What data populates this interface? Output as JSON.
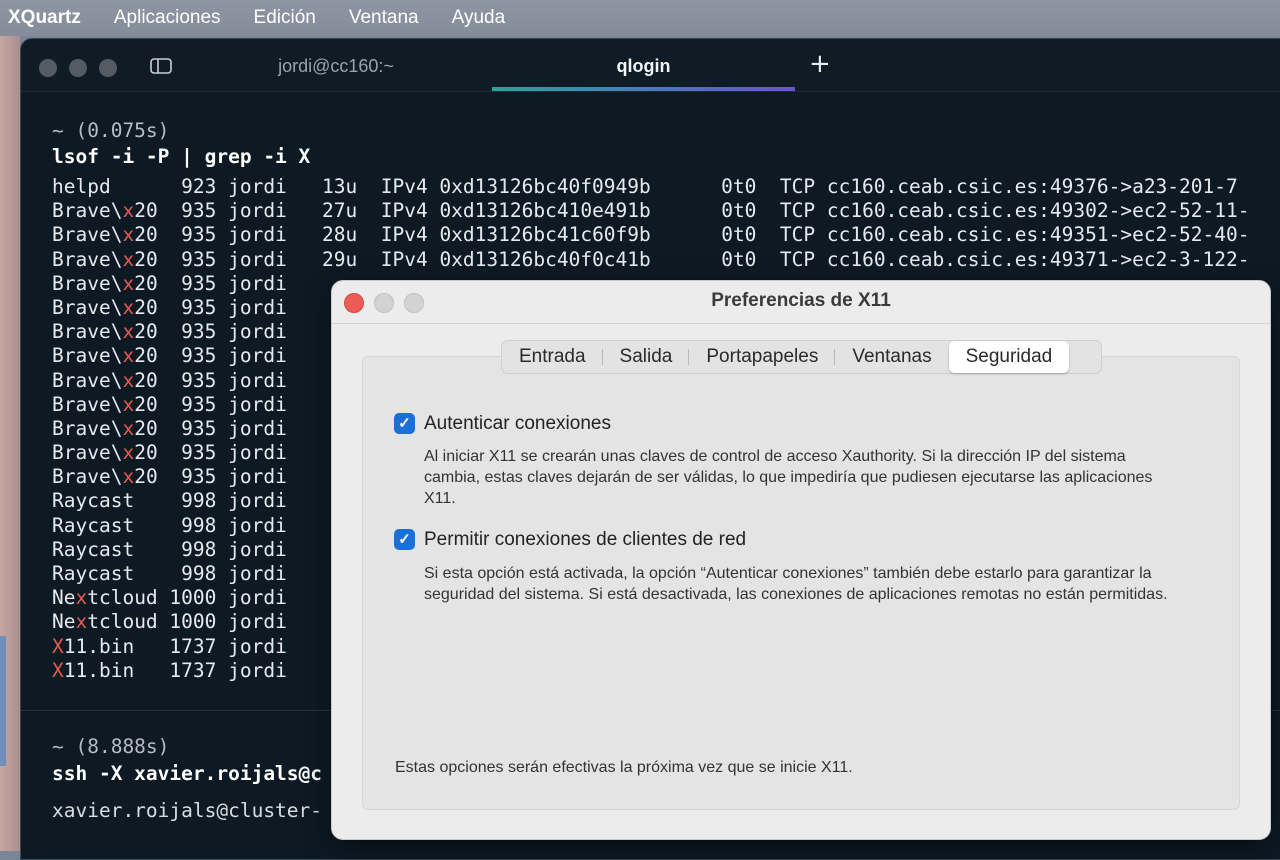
{
  "menubar": {
    "app_name": "XQuartz",
    "items": [
      "Aplicaciones",
      "Edición",
      "Ventana",
      "Ayuda"
    ]
  },
  "terminal": {
    "tabs": [
      {
        "label": "jordi@cc160:~",
        "active": false
      },
      {
        "label": "qlogin",
        "active": true
      }
    ],
    "new_tab_label": "+",
    "block1": {
      "prompt": "~ (0.075s)",
      "command": "lsof -i -P | grep -i X"
    },
    "output_lines": [
      "helpd      923 jordi   13u  IPv4 0xd13126bc40f0949b      0t0  TCP cc160.ceab.csic.es:49376->a23-201-7",
      "Brave\\x20  935 jordi   27u  IPv4 0xd13126bc410e491b      0t0  TCP cc160.ceab.csic.es:49302->ec2-52-11-",
      "Brave\\x20  935 jordi   28u  IPv4 0xd13126bc41c60f9b      0t0  TCP cc160.ceab.csic.es:49351->ec2-52-40-",
      "Brave\\x20  935 jordi   29u  IPv4 0xd13126bc40f0c41b      0t0  TCP cc160.ceab.csic.es:49371->ec2-3-122-",
      "Brave\\x20  935 jordi",
      "Brave\\x20  935 jordi",
      "Brave\\x20  935 jordi",
      "Brave\\x20  935 jordi",
      "Brave\\x20  935 jordi",
      "Brave\\x20  935 jordi",
      "Brave\\x20  935 jordi",
      "Brave\\x20  935 jordi",
      "Brave\\x20  935 jordi",
      "Raycast    998 jordi",
      "Raycast    998 jordi",
      "Raycast    998 jordi",
      "Raycast    998 jordi",
      "Nextcloud 1000 jordi",
      "Nextcloud 1000 jordi",
      "X11.bin   1737 jordi",
      "X11.bin   1737 jordi"
    ],
    "block2": {
      "prompt": "~ (8.888s)",
      "command": "ssh -X xavier.roijals@c",
      "output": "xavier.roijals@cluster-"
    }
  },
  "dialog": {
    "title": "Preferencias de X11",
    "tabs": [
      "Entrada",
      "Salida",
      "Portapapeles",
      "Ventanas",
      "Seguridad"
    ],
    "selected_tab": "Seguridad",
    "options": [
      {
        "label": "Autenticar conexiones",
        "checked": true,
        "description": "Al iniciar X11 se crearán unas claves de control de acceso Xauthority. Si la dirección IP del sistema cambia, estas claves dejarán de ser válidas, lo que impediría que pudiesen ejecutarse las aplicaciones X11."
      },
      {
        "label": "Permitir conexiones de clientes de red",
        "checked": true,
        "description": "Si esta opción está activada, la opción “Autenticar conexiones” también debe estarlo para garantizar la seguridad del sistema. Si está desactivada, las conexiones de aplicaciones remotas no están permitidas."
      }
    ],
    "footer": "Estas opciones serán efectivas la próxima vez que se inicie X11."
  },
  "colors": {
    "terminal_bg": "#0d1a24",
    "match_highlight": "#e8594f",
    "checkbox_blue": "#1a6fd9",
    "close_red": "#ec5b55"
  }
}
